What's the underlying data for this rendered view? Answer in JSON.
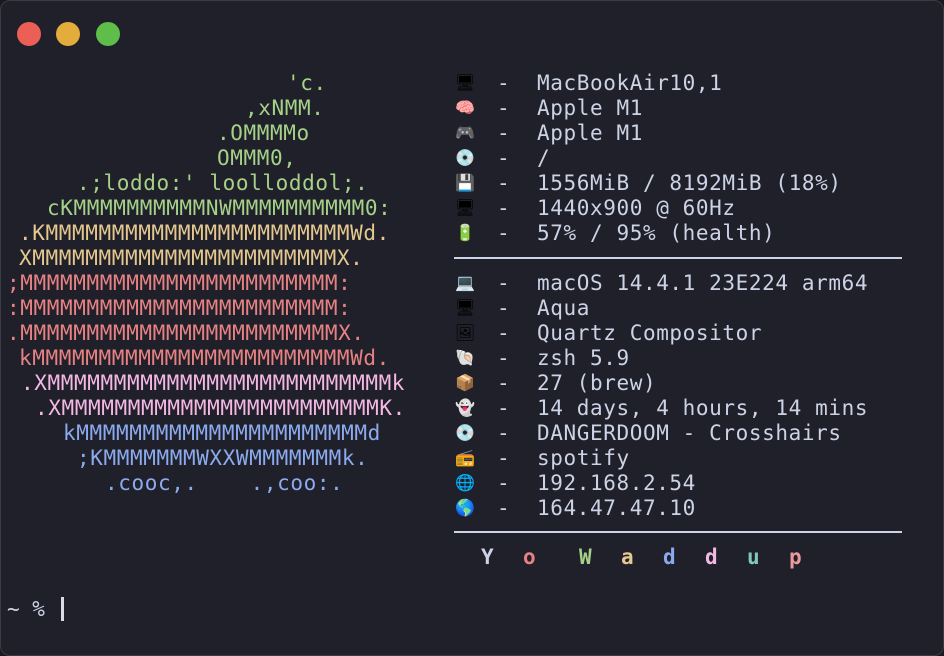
{
  "window": {
    "traffic_lights": [
      {
        "name": "close",
        "color": "#ec5f57"
      },
      {
        "name": "minimize",
        "color": "#e4ad3b"
      },
      {
        "name": "maximize",
        "color": "#5fbd4a"
      }
    ]
  },
  "logo": [
    {
      "text": "'c.",
      "color": "green"
    },
    {
      "text": ",xNMM.",
      "color": "green"
    },
    {
      "text": ".OMMMMo",
      "color": "green"
    },
    {
      "text": "OMMM0,",
      "color": "green"
    },
    {
      "text": ".;loddo:' loolloddol;.",
      "color": "green"
    },
    {
      "text": "cKMMMMMMMMMMNWMMMMMMMMMM0:",
      "color": "green"
    },
    {
      "text": ".KMMMMMMMMMMMMMMMMMMMMMMMWd.",
      "color": "yellow"
    },
    {
      "text": "XMMMMMMMMMMMMMMMMMMMMMMMX.",
      "color": "yellow"
    },
    {
      "text": ";MMMMMMMMMMMMMMMMMMMMMMMM:",
      "color": "red"
    },
    {
      "text": ":MMMMMMMMMMMMMMMMMMMMMMMM:",
      "color": "red"
    },
    {
      "text": ".MMMMMMMMMMMMMMMMMMMMMMMMX.",
      "color": "red"
    },
    {
      "text": "kMMMMMMMMMMMMMMMMMMMMMMMMWd.",
      "color": "red"
    },
    {
      "text": ".XMMMMMMMMMMMMMMMMMMMMMMMMMMk",
      "color": "pink"
    },
    {
      "text": ".XMMMMMMMMMMMMMMMMMMMMMMMMK.",
      "color": "pink"
    },
    {
      "text": "kMMMMMMMMMMMMMMMMMMMMMMd",
      "color": "blue"
    },
    {
      "text": ";KMMMMMMMWXXWMMMMMMMk.",
      "color": "blue"
    },
    {
      "text": ".cooc,.    .,coo:.",
      "color": "blue"
    }
  ],
  "info_hardware": [
    {
      "icon": "monitor-icon",
      "glyph": "🖥",
      "value": "MacBookAir10,1"
    },
    {
      "icon": "brain-icon",
      "glyph": "🧠",
      "value": "Apple M1"
    },
    {
      "icon": "gamepad-icon",
      "glyph": "🎮",
      "value": "Apple M1"
    },
    {
      "icon": "disc-icon",
      "glyph": "💿",
      "value": "/"
    },
    {
      "icon": "floppy-icon",
      "glyph": "💾",
      "value": "1556MiB / 8192MiB (18%)"
    },
    {
      "icon": "monitor-icon",
      "glyph": "🖥",
      "value": "1440x900 @ 60Hz"
    },
    {
      "icon": "battery-icon",
      "glyph": "🔋",
      "value": "57% / 95% (health)"
    }
  ],
  "info_software": [
    {
      "icon": "laptop-icon",
      "glyph": "💻",
      "value": "macOS 14.4.1 23E224 arm64"
    },
    {
      "icon": "monitor-icon",
      "glyph": "🖥",
      "value": "Aqua"
    },
    {
      "icon": "framed-picture-icon",
      "glyph": "🖼",
      "value": "Quartz Compositor"
    },
    {
      "icon": "shell-icon",
      "glyph": "🐚",
      "value": "zsh 5.9"
    },
    {
      "icon": "package-icon",
      "glyph": "📦",
      "value": "27 (brew)"
    },
    {
      "icon": "ghost-icon",
      "glyph": "👻",
      "value": "14 days, 4 hours, 14 mins"
    },
    {
      "icon": "disc-icon",
      "glyph": "💿",
      "value": "DANGERDOOM - Crosshairs"
    },
    {
      "icon": "radio-icon",
      "glyph": "📻",
      "value": "spotify"
    },
    {
      "icon": "globe-icon",
      "glyph": "🌐",
      "value": "192.168.2.54"
    },
    {
      "icon": "earth-icon",
      "glyph": "🌎",
      "value": "164.47.47.10"
    }
  ],
  "separator": "-",
  "greeting": [
    {
      "char": "Y",
      "color": "#cdd3e6"
    },
    {
      "char": "o",
      "color": "#e78284"
    },
    {
      "char": "W",
      "color": "#a6d189"
    },
    {
      "char": "a",
      "color": "#e5c890"
    },
    {
      "char": "d",
      "color": "#8caaee"
    },
    {
      "char": "d",
      "color": "#f4b8e4"
    },
    {
      "char": "u",
      "color": "#81c8be"
    },
    {
      "char": "p",
      "color": "#ea999c"
    }
  ],
  "prompt": {
    "text": "~ %"
  }
}
